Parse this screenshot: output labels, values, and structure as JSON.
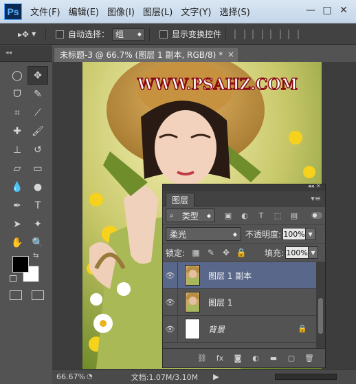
{
  "app": {
    "logo": "Ps"
  },
  "menu": [
    "文件(F)",
    "编辑(E)",
    "图像(I)",
    "图层(L)",
    "文字(Y)",
    "选择(S)"
  ],
  "window_controls": [
    "—",
    "□",
    "✕"
  ],
  "options": {
    "tool_glyph": "▸✥",
    "auto_select_label": "自动选择：",
    "auto_select_value": "组",
    "show_transform_label": "显示变换控件"
  },
  "tools_panel": {
    "collapse": "◂◂"
  },
  "tools": [
    {
      "name": "marquee-tool-icon",
      "glyph": "◯"
    },
    {
      "name": "move-tool-icon",
      "glyph": "✥",
      "active": true
    },
    {
      "name": "lasso-tool-icon",
      "glyph": "ᗜ"
    },
    {
      "name": "quick-select-tool-icon",
      "glyph": "✎"
    },
    {
      "name": "crop-tool-icon",
      "glyph": "⌗"
    },
    {
      "name": "eyedropper-tool-icon",
      "glyph": "⟋"
    },
    {
      "name": "healing-brush-tool-icon",
      "glyph": "✚"
    },
    {
      "name": "brush-tool-icon",
      "glyph": "🖌"
    },
    {
      "name": "clone-stamp-tool-icon",
      "glyph": "⊥"
    },
    {
      "name": "history-brush-tool-icon",
      "glyph": "↺"
    },
    {
      "name": "eraser-tool-icon",
      "glyph": "▱"
    },
    {
      "name": "gradient-tool-icon",
      "glyph": "▭"
    },
    {
      "name": "blur-tool-icon",
      "glyph": "💧"
    },
    {
      "name": "dodge-tool-icon",
      "glyph": "●"
    },
    {
      "name": "pen-tool-icon",
      "glyph": "✒"
    },
    {
      "name": "type-tool-icon",
      "glyph": "T"
    },
    {
      "name": "path-select-tool-icon",
      "glyph": "➤"
    },
    {
      "name": "shape-tool-icon",
      "glyph": "✦"
    },
    {
      "name": "hand-tool-icon",
      "glyph": "✋"
    },
    {
      "name": "zoom-tool-icon",
      "glyph": "🔍"
    }
  ],
  "document": {
    "tab_title": "未标题-3 @ 66.7% (图层 1 副本, RGB/8) *",
    "close": "×",
    "watermark": "WWW.PSAHZ.COM"
  },
  "status": {
    "zoom": "66.67%",
    "info": "文档:1.07M/3.10M",
    "arrow": "▶"
  },
  "layers_panel": {
    "collapse": "◂◂  ✕",
    "tab": "图层",
    "menu": "▾≡",
    "filter_kind": "类型",
    "blend_mode": "柔光",
    "opacity_label": "不透明度:",
    "opacity_value": "100%",
    "lock_label": "锁定:",
    "fill_label": "填充:",
    "fill_value": "100%",
    "layers": [
      {
        "name": "图层 1 副本",
        "selected": true,
        "thumb": "photo",
        "locked": false
      },
      {
        "name": "图层 1",
        "selected": false,
        "thumb": "photo",
        "locked": false
      },
      {
        "name": "背景",
        "selected": false,
        "thumb": "white",
        "locked": true
      }
    ],
    "footer_icons": [
      "link-icon",
      "fx-icon",
      "mask-icon",
      "adjustment-icon",
      "group-icon",
      "new-layer-icon",
      "delete-icon"
    ]
  },
  "colors": {
    "foreground": "#000000",
    "background": "#ffffff",
    "selection": "#59678a",
    "watermark": "#ffffff",
    "watermark_outline": "#8b0a14"
  }
}
